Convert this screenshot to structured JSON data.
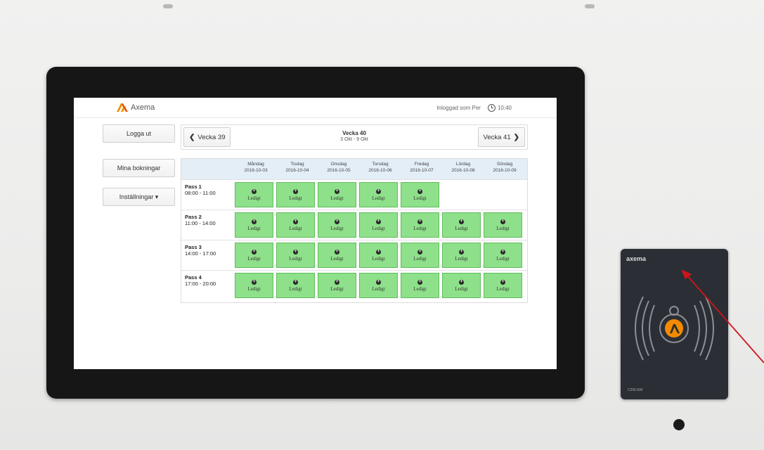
{
  "app": {
    "brand": "Axema"
  },
  "header": {
    "user_text": "Inloggad som Per",
    "time": "10:40"
  },
  "sidebar": {
    "logout": "Logga ut",
    "my_bookings": "Mina bokningar",
    "settings": "Inställningar ▾"
  },
  "week_nav": {
    "prev": "Vecka 39",
    "next": "Vecka 41",
    "title": "Vecka 40",
    "range": "3 Okt - 9 Okt"
  },
  "days": [
    {
      "name": "Måndag",
      "date": "2016-10-03"
    },
    {
      "name": "Tisdag",
      "date": "2016-10-04"
    },
    {
      "name": "Onsdag",
      "date": "2016-10-05"
    },
    {
      "name": "Torsdag",
      "date": "2016-10-06"
    },
    {
      "name": "Fredag",
      "date": "2016-10-07"
    },
    {
      "name": "Lördag",
      "date": "2016-10-08"
    },
    {
      "name": "Söndag",
      "date": "2016-10-09"
    }
  ],
  "passes": [
    {
      "name": "Pass 1",
      "time": "08:00 - 11:00",
      "slots": [
        true,
        true,
        true,
        true,
        true,
        false,
        false
      ]
    },
    {
      "name": "Pass 2",
      "time": "11:00 - 14:00",
      "slots": [
        true,
        true,
        true,
        true,
        true,
        true,
        true
      ]
    },
    {
      "name": "Pass 3",
      "time": "14:00 - 17:00",
      "slots": [
        true,
        true,
        true,
        true,
        true,
        true,
        true
      ]
    },
    {
      "name": "Pass 4",
      "time": "17:00 - 20:00",
      "slots": [
        true,
        true,
        true,
        true,
        true,
        true,
        true
      ]
    }
  ],
  "slot_label": "Ledigt",
  "colors": {
    "slot_fill": "#8ee08a",
    "header_bg": "#e4eef7",
    "logo_orange": "#f28b00",
    "annotation_arrow": "#d0141b"
  },
  "reader": {
    "brand": "axema",
    "model": "C200-EM"
  }
}
